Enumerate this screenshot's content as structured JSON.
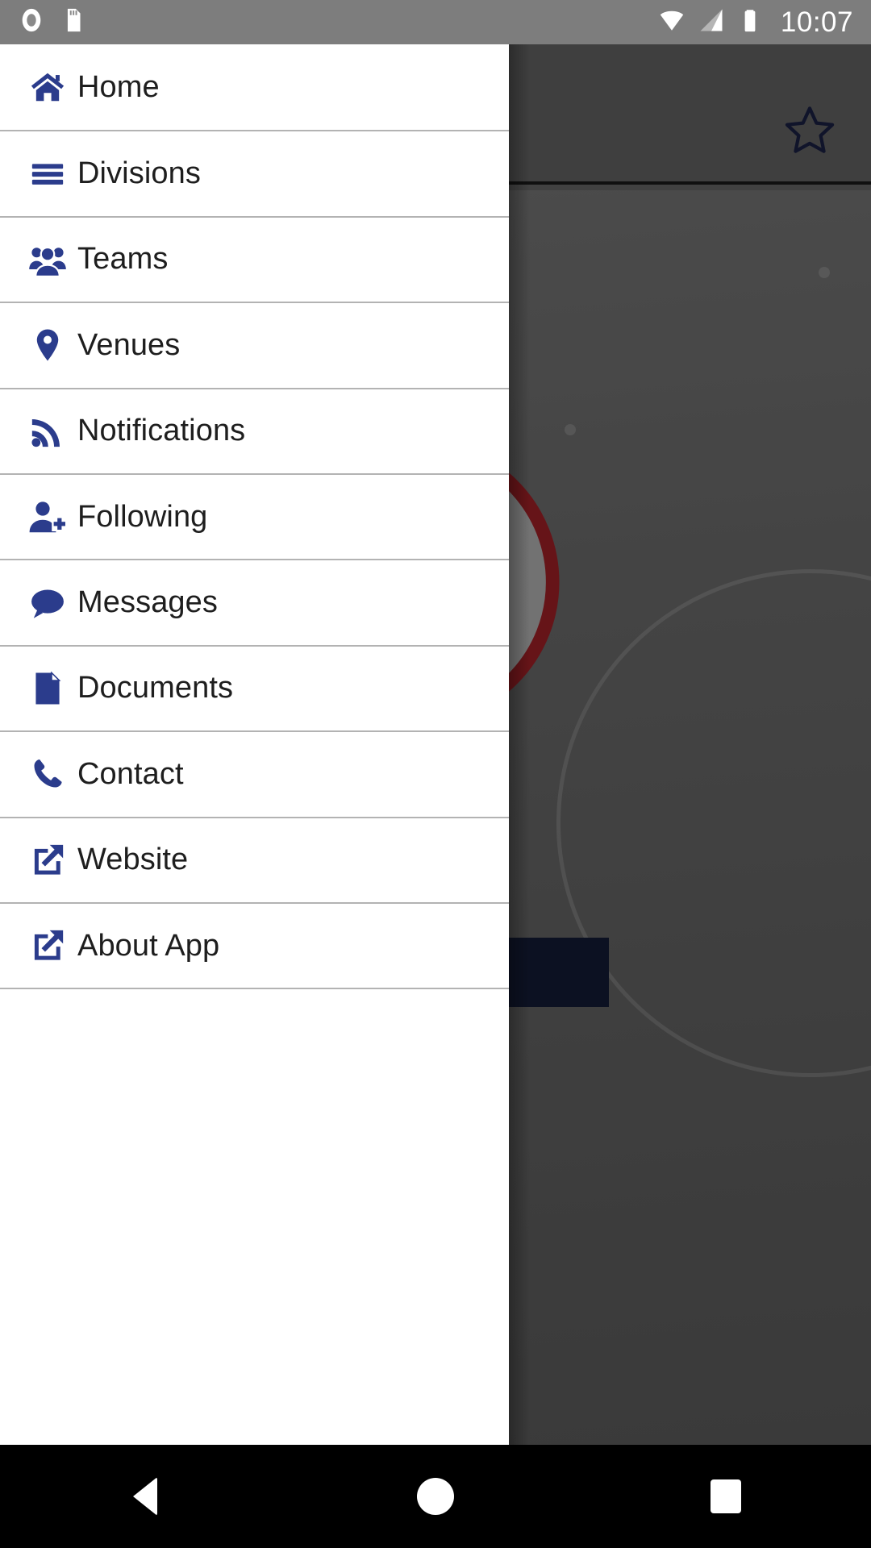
{
  "status_bar": {
    "time": "10:07",
    "left_icons": [
      {
        "name": "record-indicator-icon",
        "glyph": "◉"
      },
      {
        "name": "sd-card-icon",
        "glyph": "▮"
      }
    ],
    "right_icons": [
      {
        "name": "wifi-icon",
        "glyph": "▼"
      },
      {
        "name": "cell-signal-icon",
        "glyph": "◢"
      },
      {
        "name": "battery-icon",
        "glyph": "▮"
      }
    ]
  },
  "app_bar": {
    "favorite_icon": "star-outline-icon",
    "favorite_label": "Favorite"
  },
  "background": {
    "logo_name": "league-circular-logo",
    "trademark": "®",
    "colors": {
      "logo_ring_red": "#a52128",
      "logo_navy": "#1b2a5e",
      "banner_navy": "#141c38",
      "scrim": "rgba(0,0,0,0.38)"
    }
  },
  "drawer": {
    "accent_color": "#2b3c8c",
    "items": [
      {
        "label": "Home",
        "icon": "home-icon"
      },
      {
        "label": "Divisions",
        "icon": "hamburger-lines-icon"
      },
      {
        "label": "Teams",
        "icon": "users-group-icon"
      },
      {
        "label": "Venues",
        "icon": "map-marker-icon"
      },
      {
        "label": "Notifications",
        "icon": "rss-feed-icon"
      },
      {
        "label": "Following",
        "icon": "user-plus-icon"
      },
      {
        "label": "Messages",
        "icon": "chat-bubble-icon"
      },
      {
        "label": "Documents",
        "icon": "file-document-icon"
      },
      {
        "label": "Contact",
        "icon": "phone-icon"
      },
      {
        "label": "Website",
        "icon": "external-link-icon"
      },
      {
        "label": "About App",
        "icon": "external-link-icon"
      }
    ]
  },
  "nav_bar": {
    "buttons": [
      {
        "label": "Back",
        "icon": "back-triangle-icon"
      },
      {
        "label": "Home",
        "icon": "home-circle-icon"
      },
      {
        "label": "Recents",
        "icon": "recents-square-icon"
      }
    ]
  }
}
